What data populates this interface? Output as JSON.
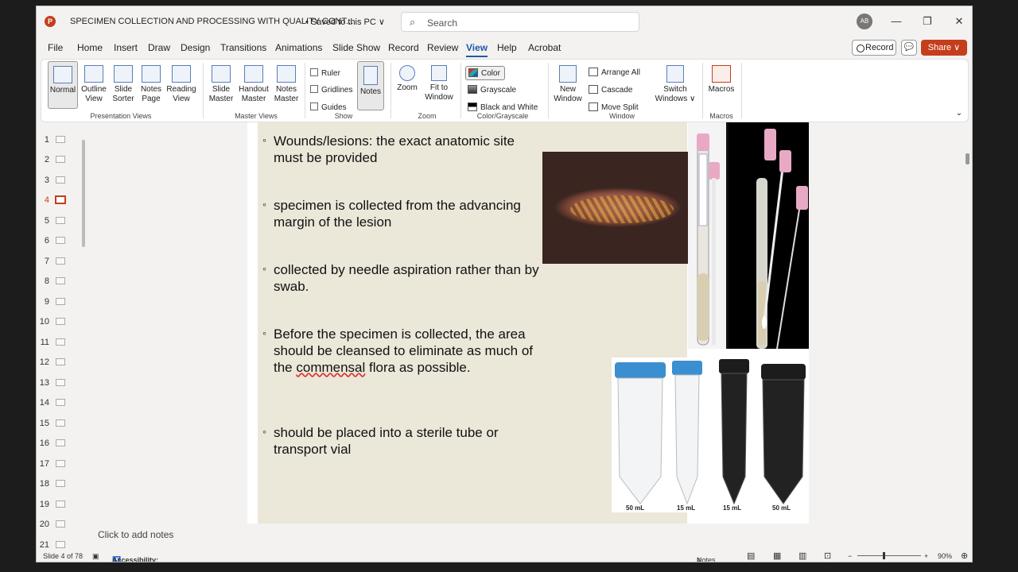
{
  "title_bar": {
    "app_letter": "P",
    "doc_title": "SPECIMEN COLLECTION AND PROCESSING WITH QUALITY CONT...",
    "save_state": "• Saved to this PC ∨",
    "search_placeholder": "Search",
    "avatar_initials": "AB",
    "minimize": "—",
    "restore": "❐",
    "close": "✕"
  },
  "tabs": [
    "File",
    "Home",
    "Insert",
    "Draw",
    "Design",
    "Transitions",
    "Animations",
    "Slide Show",
    "Record",
    "Review",
    "View",
    "Help",
    "Acrobat"
  ],
  "active_tab": "View",
  "header_buttons": {
    "record": "Record",
    "comment": "💬",
    "share": "Share ∨"
  },
  "ribbon": {
    "presentation_views": {
      "label": "Presentation Views",
      "items": [
        "Normal",
        "Outline View",
        "Slide Sorter",
        "Notes Page",
        "Reading View"
      ]
    },
    "master_views": {
      "label": "Master Views",
      "items": [
        "Slide Master",
        "Handout Master",
        "Notes Master"
      ]
    },
    "show": {
      "label": "Show",
      "checks": [
        "Ruler",
        "Gridlines",
        "Guides"
      ],
      "notes": "Notes"
    },
    "zoom": {
      "label": "Zoom",
      "items": [
        "Zoom",
        "Fit to Window"
      ]
    },
    "color": {
      "label": "Color/Grayscale",
      "items": [
        "Color",
        "Grayscale",
        "Black and White"
      ]
    },
    "window": {
      "label": "Window",
      "new_window": "New Window",
      "items": [
        "Arrange All",
        "Cascade",
        "Move Split"
      ],
      "switch": "Switch Windows ∨"
    },
    "macros": {
      "label": "Macros",
      "item": "Macros"
    }
  },
  "thumbnails": [
    "1",
    "2",
    "3",
    "4",
    "5",
    "6",
    "7",
    "8",
    "9",
    "10",
    "11",
    "12",
    "13",
    "14",
    "15",
    "16",
    "17",
    "18",
    "19",
    "20",
    "21"
  ],
  "active_slide": 4,
  "slide": {
    "bullets": [
      "Wounds/lesions: the exact anatomic site must be provided",
      "specimen is collected from the advancing margin of the lesion",
      " collected by needle aspiration rather than by swab.",
      "Before the specimen is collected, the area should be cleansed to eliminate as much of the",
      "commensal",
      "flora as possible.",
      "should be placed into a sterile tube or transport vial"
    ],
    "tube_labels": [
      "50 mL",
      "15 mL",
      "15 mL",
      "50 mL"
    ]
  },
  "notes_placeholder": "Click to add notes",
  "status": {
    "slide_of": "Slide 4 of 78",
    "accessibility": "Accessibility: Investigate",
    "notes": "Notes",
    "zoom": "90%"
  },
  "colors": {
    "accent": "#c43e1c",
    "tab_active": "#1f5aa6"
  }
}
